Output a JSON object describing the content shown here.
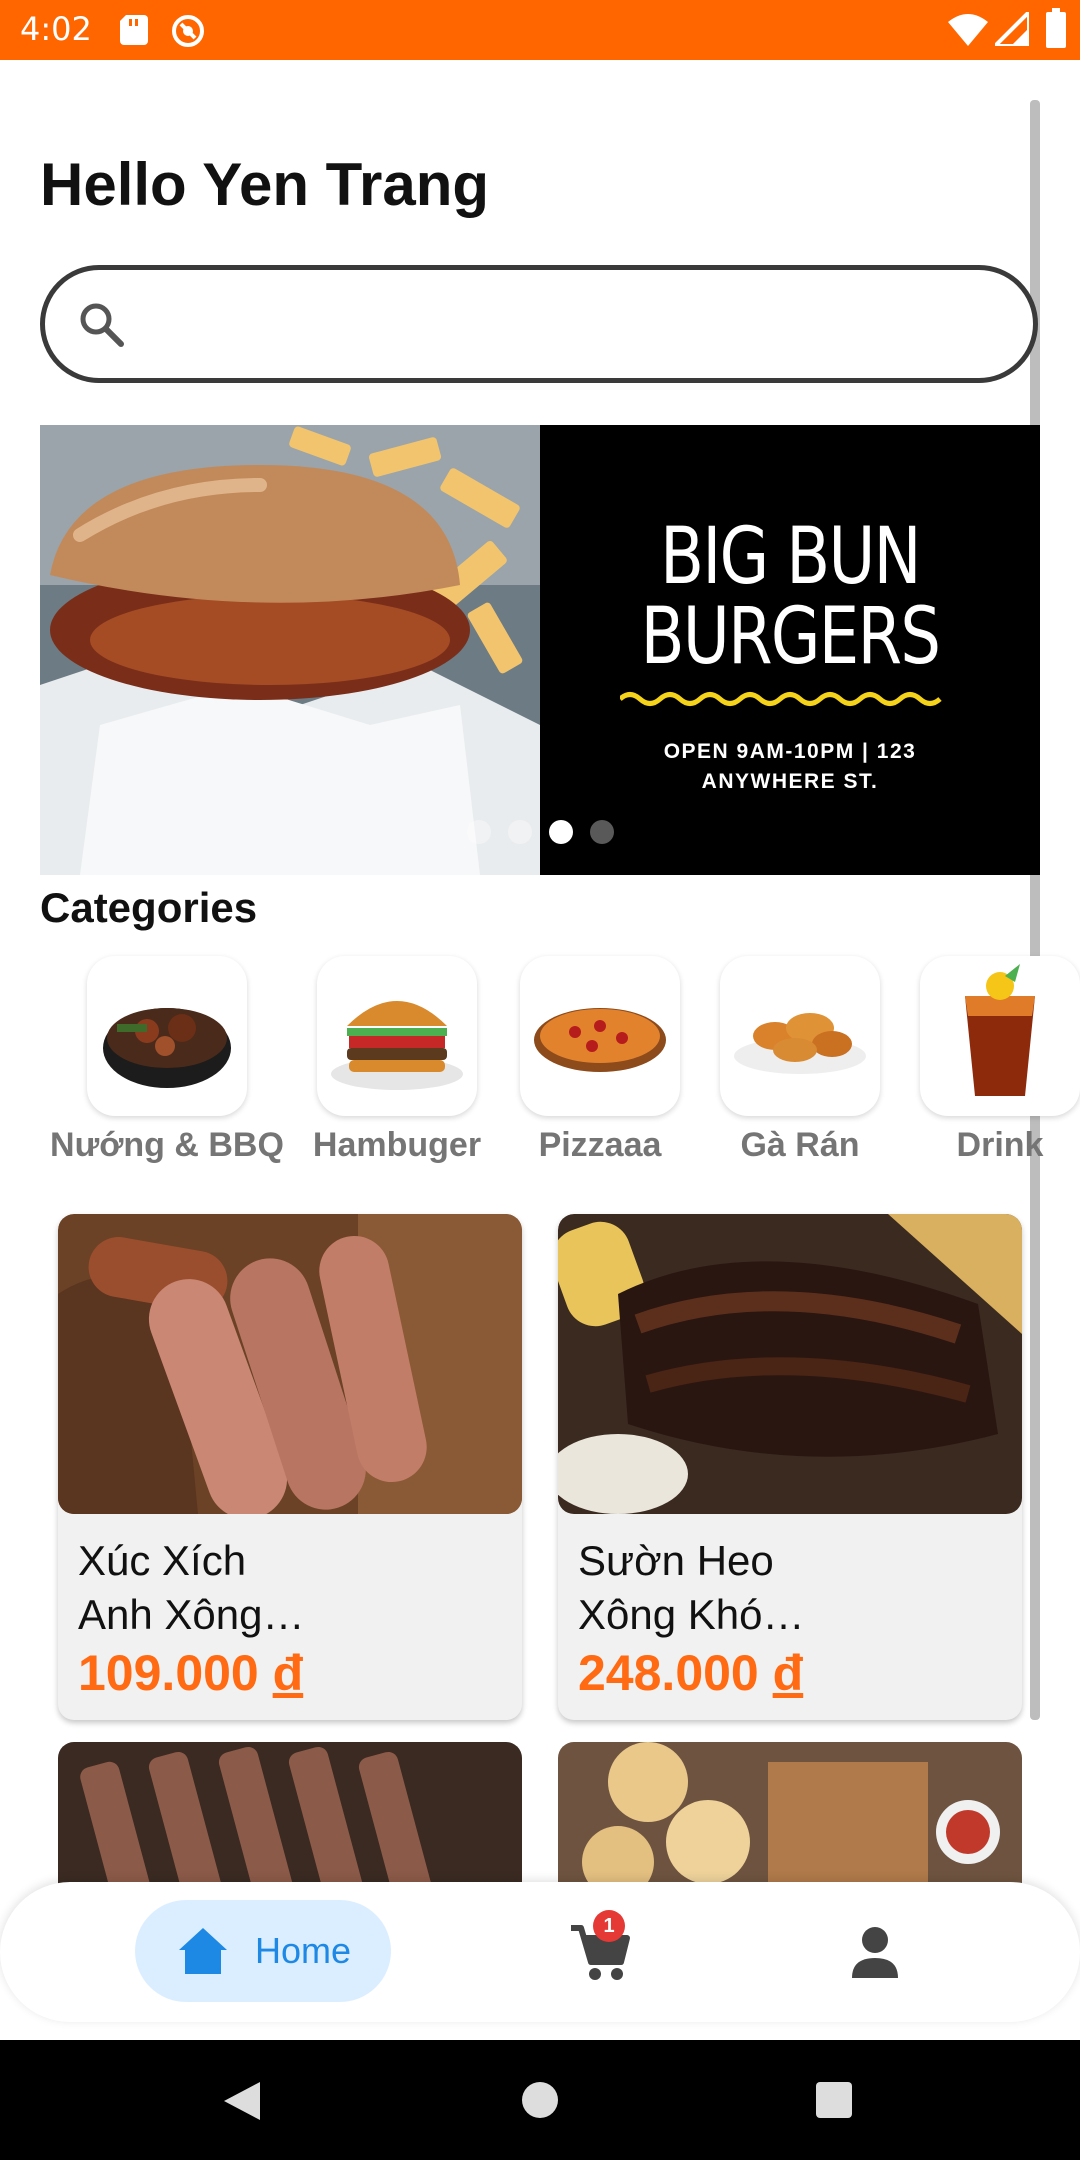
{
  "status_bar": {
    "time": "4:02",
    "color": "#ff6600"
  },
  "greeting": "Hello Yen Trang",
  "search": {
    "placeholder": "",
    "value": ""
  },
  "banner": {
    "title": "BIG BUN\nBURGERS",
    "subtitle": "OPEN 9AM-10PM | 123\nANYWHERE ST.",
    "dot_count": 4,
    "active_dot": 2
  },
  "categories_title": "Categories",
  "categories": [
    {
      "label": "Nướng & BBQ",
      "icon": "bbq-platter-icon"
    },
    {
      "label": "Hambuger",
      "icon": "hamburger-icon"
    },
    {
      "label": "Pizzaaa",
      "icon": "pizza-icon"
    },
    {
      "label": "Gà Rán",
      "icon": "fried-chicken-icon"
    },
    {
      "label": "Drink",
      "icon": "drink-icon"
    }
  ],
  "products": [
    {
      "name": "Xúc Xích\nAnh Xông…",
      "price": "109.000",
      "currency": "đ"
    },
    {
      "name": "Sườn Heo\nXông Khó…",
      "price": "248.000",
      "currency": "đ"
    }
  ],
  "bottom_nav": {
    "home_label": "Home",
    "cart_badge": "1",
    "accent": "#1e88e5",
    "active_bg": "#dbeeff"
  },
  "colors": {
    "price": "#ff6a13",
    "badge": "#e53935"
  }
}
